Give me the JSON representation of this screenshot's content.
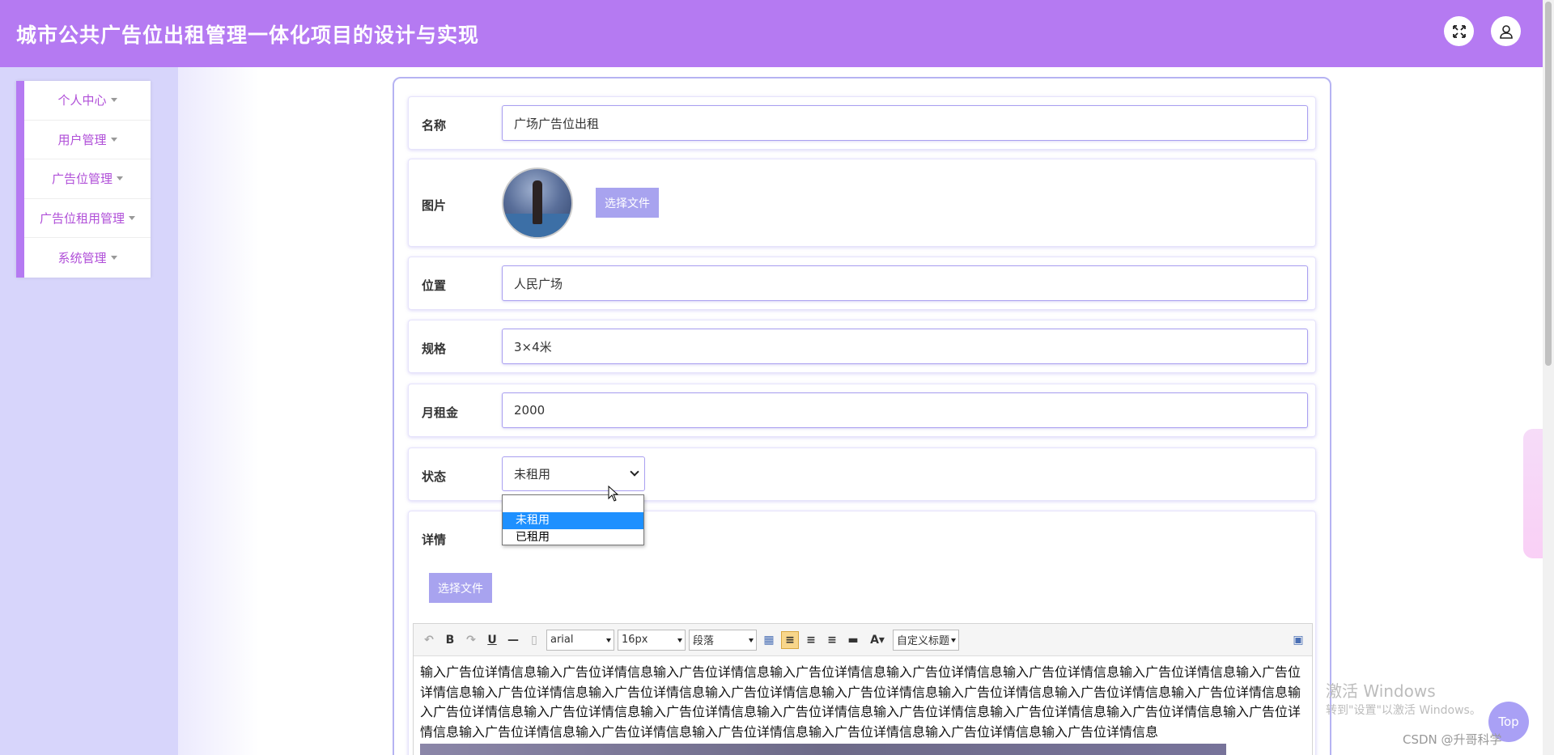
{
  "header": {
    "title": "城市公共广告位出租管理一体化项目的设计与实现"
  },
  "sidebar": {
    "items": [
      {
        "label": "个人中心"
      },
      {
        "label": "用户管理"
      },
      {
        "label": "广告位管理"
      },
      {
        "label": "广告位租用管理"
      },
      {
        "label": "系统管理"
      }
    ]
  },
  "form": {
    "name": {
      "label": "名称",
      "value": "广场广告位出租"
    },
    "image": {
      "label": "图片",
      "button": "选择文件"
    },
    "location": {
      "label": "位置",
      "value": "人民广场"
    },
    "spec": {
      "label": "规格",
      "value": "3×4米"
    },
    "rent": {
      "label": "月租金",
      "value": "2000"
    },
    "status": {
      "label": "状态",
      "value": "未租用",
      "options": [
        "",
        "未租用",
        "已租用"
      ]
    },
    "detail": {
      "label": "详情",
      "button": "选择文件",
      "toolbar": {
        "font": "arial",
        "size": "16px",
        "paragraph": "段落",
        "custom_title": "自定义标题"
      },
      "content": "输入广告位详情信息输入广告位详情信息输入广告位详情信息输入广告位详情信息输入广告位详情信息输入广告位详情信息输入广告位详情信息输入广告位详情信息输入广告位详情信息输入广告位详情信息输入广告位详情信息输入广告位详情信息输入广告位详情信息输入广告位详情信息输入广告位详情信息输入广告位详情信息输入广告位详情信息输入广告位详情信息输入广告位详情信息输入广告位详情信息输入广告位详情信息输入广告位详情信息输入广告位详情信息输入广告位详情信息输入广告位详情信息输入广告位详情信息输入广告位详情信息输入广告位详情信息输入广告位详情信息"
    }
  },
  "overlay": {
    "watermark_title": "激活 Windows",
    "watermark_sub": "转到\"设置\"以激活 Windows。",
    "top_button": "Top",
    "csdn": "CSDN @升哥科学"
  },
  "colors": {
    "header": "#b57af2",
    "sidebar": "#d7d5fb",
    "accent": "#a8a3ef",
    "menu_text": "#b04fd8"
  }
}
